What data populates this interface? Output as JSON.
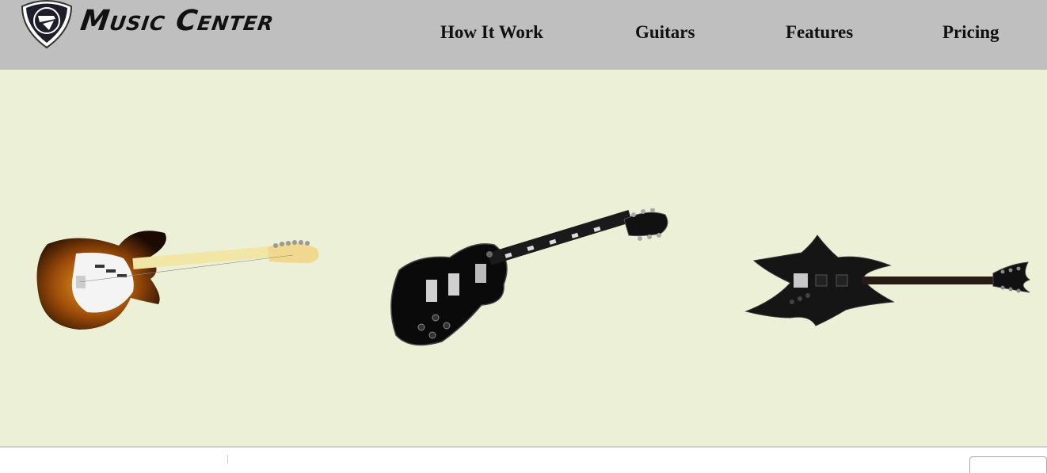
{
  "header": {
    "logo_text": "Music Center",
    "nav": [
      {
        "label": "How It Work"
      },
      {
        "label": "Guitars"
      },
      {
        "label": "Features"
      },
      {
        "label": "Pricing"
      }
    ]
  },
  "hero": {
    "guitars": [
      {
        "icon": "stratocaster-guitar-icon"
      },
      {
        "icon": "les-paul-guitar-icon"
      },
      {
        "icon": "warlock-guitar-icon"
      }
    ]
  },
  "colors": {
    "header_bg": "#bfbfbf",
    "hero_bg": "#ebf0d6",
    "sunburst": "#8a4a0a",
    "maple": "#f2e6a6"
  }
}
